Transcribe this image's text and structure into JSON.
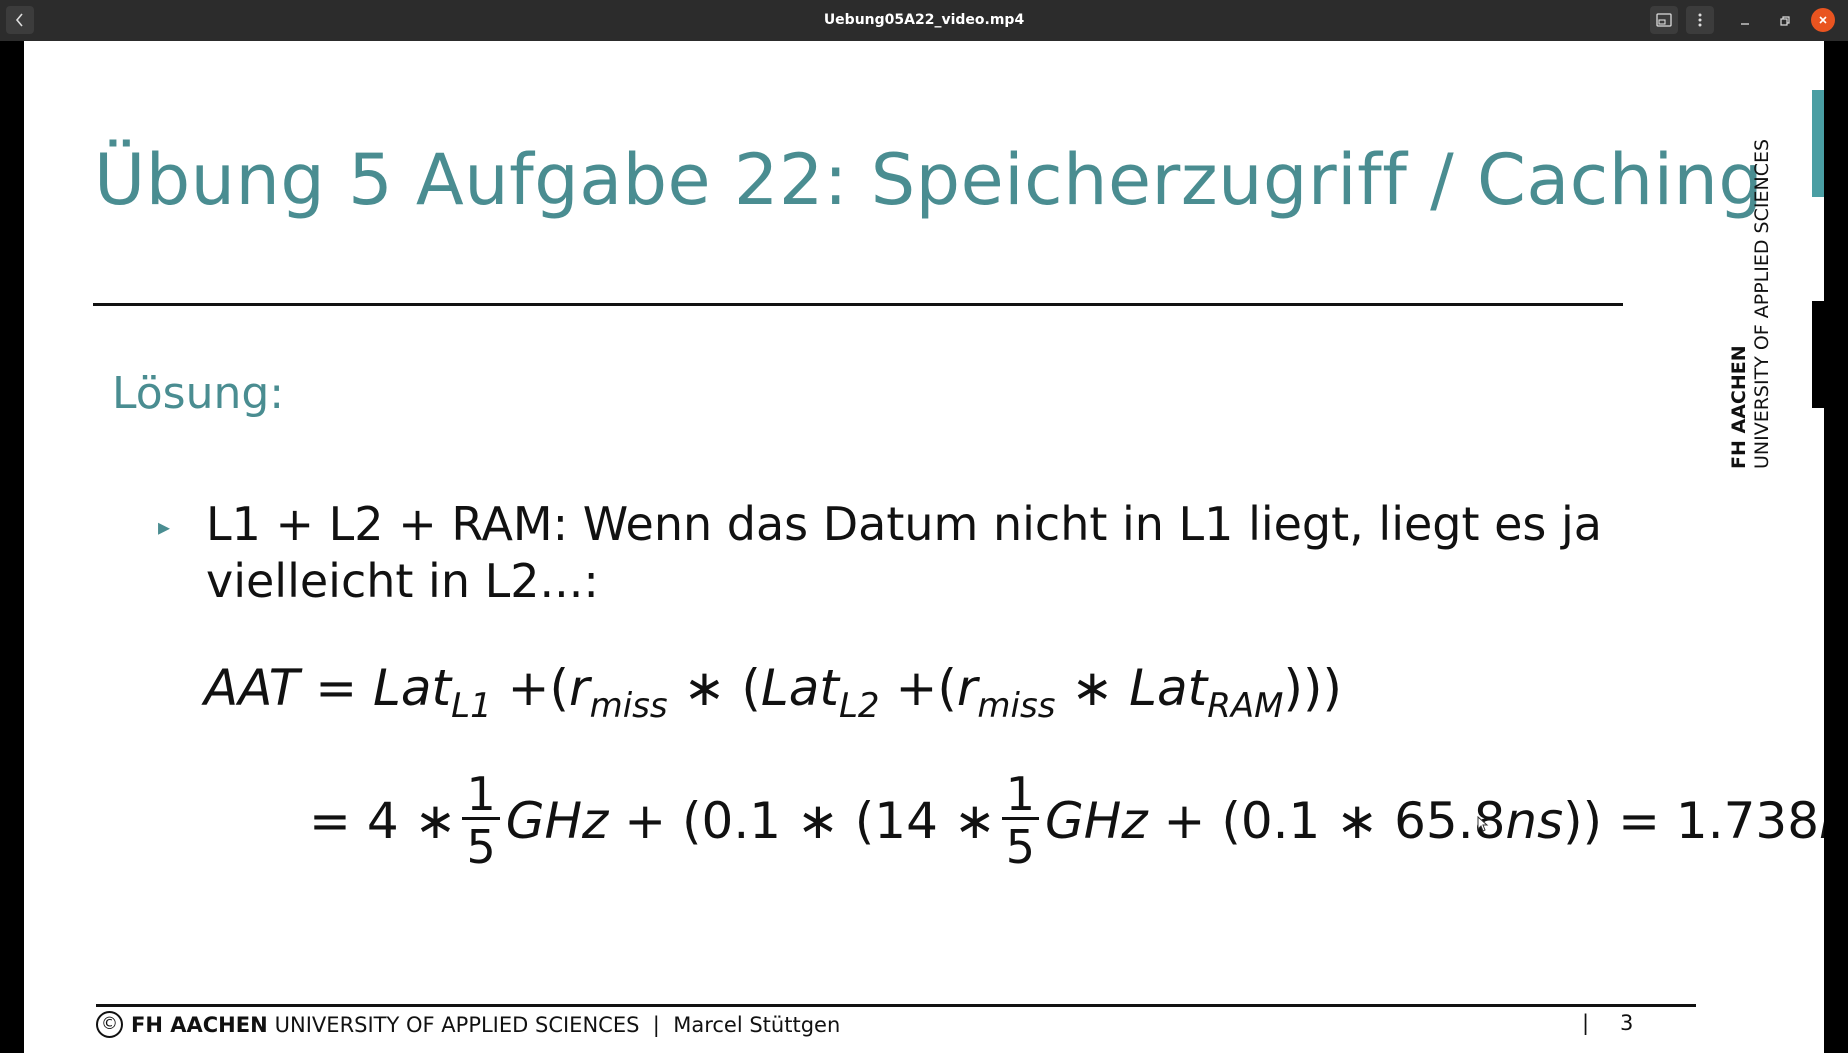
{
  "window": {
    "title": "Uebung05A22_video.mp4",
    "back_icon": "chevron-left-icon",
    "minimize_glyph": "–",
    "maximize_glyph": "▫",
    "close_glyph": "✕"
  },
  "slide": {
    "title": "Übung 5 Aufgabe 22: Speicherzugriff / Caching",
    "side_logo_bold": "FH AACHEN",
    "side_logo_text": "UNIVERSITY OF APPLIED SCIENCES",
    "section_heading": "Lösung:",
    "bullet_marker": "▸",
    "bullet_text": "L1 + L2 + RAM: Wenn das Datum nicht in L1 liegt, liegt es ja vielleicht in L2...:",
    "equation_1": {
      "lhs": "AAT",
      "eq": "=",
      "lat": "Lat",
      "l1": "L1",
      "plus": "+",
      "open": "(",
      "r": "r",
      "miss": "miss",
      "star": "∗",
      "l2": "L2",
      "ram": "RAM",
      "close": ")))"
    },
    "equation_2": {
      "eq": "=",
      "four": "4",
      "star": "∗",
      "num": "1",
      "den": "5",
      "ghz": "GHz",
      "plus": "+",
      "part_a": "(0.1",
      "part_b": "(14",
      "part_c": "(0.1",
      "ram_val": "65.8",
      "ns": "ns",
      "close": "))",
      "result": "1.738"
    },
    "footer": {
      "copyright": "©",
      "org_bold": "FH AACHEN",
      "org_rest": "UNIVERSITY OF APPLIED SCIENCES",
      "separator": "|",
      "author": "Marcel Stüttgen",
      "page_separator": "|",
      "page_number": "3"
    }
  },
  "colors": {
    "accent_teal": "#4a8d91",
    "side_bar_teal": "#4a9ea3",
    "titlebar": "#2c2c2c",
    "close_button": "#e95420"
  }
}
